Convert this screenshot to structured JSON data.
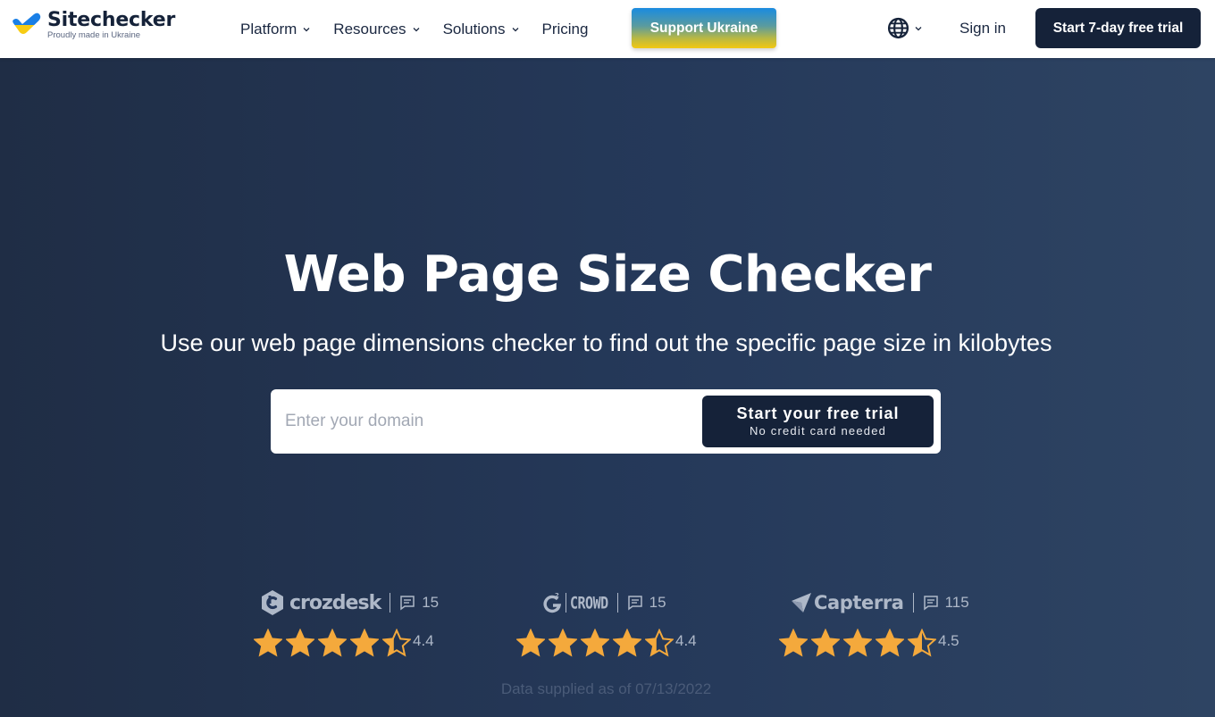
{
  "header": {
    "brand_name": "Sitechecker",
    "brand_tagline": "Proudly made in Ukraine",
    "nav": [
      {
        "label": "Platform",
        "has_dropdown": true
      },
      {
        "label": "Resources",
        "has_dropdown": true
      },
      {
        "label": "Solutions",
        "has_dropdown": true
      },
      {
        "label": "Pricing",
        "has_dropdown": false
      }
    ],
    "support_label": "Support Ukraine",
    "language_icon": "globe-icon",
    "signin_label": "Sign in",
    "trial_label": "Start 7-day free trial"
  },
  "hero": {
    "title": "Web Page Size Checker",
    "subtitle": "Use our web page dimensions checker to find out the specific page size in kilobytes",
    "input_placeholder": "Enter your domain",
    "input_value": "",
    "cta_main": "Start your free trial",
    "cta_sub": "No credit card needed"
  },
  "reviews": [
    {
      "platform": "crozdesk",
      "count": "15",
      "rating": "4.4",
      "stars": 4.4
    },
    {
      "platform": "CROWD",
      "count": "15",
      "rating": "4.4",
      "stars": 4.4
    },
    {
      "platform": "Capterra",
      "count": "115",
      "rating": "4.5",
      "stars": 4.5
    }
  ],
  "data_note": "Data supplied as of 07/13/2022",
  "colors": {
    "brand_navy": "#152239",
    "star": "#f4a93c",
    "ukraine_blue": "#1a8be0",
    "ukraine_yellow": "#f2c812"
  }
}
